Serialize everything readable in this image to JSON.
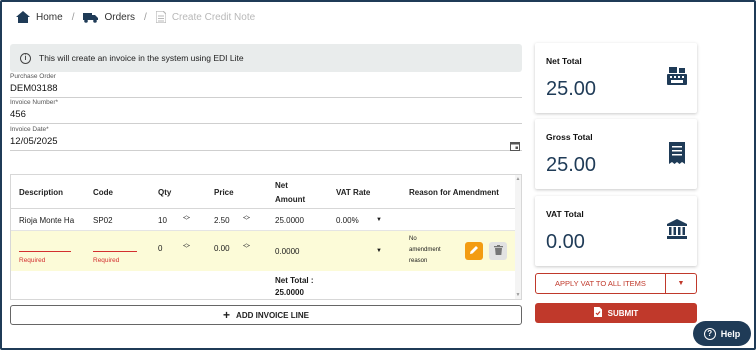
{
  "breadcrumb": {
    "home": "Home",
    "orders": "Orders",
    "current": "Create Credit Note"
  },
  "info": {
    "message": "This will create an invoice in the system using EDI Lite"
  },
  "form": {
    "purchase_order": {
      "label": "Purchase Order",
      "value": "DEM03188"
    },
    "invoice_number": {
      "label": "Invoice Number*",
      "value": "456"
    },
    "invoice_date": {
      "label": "Invoice Date*",
      "value": "12/05/2025"
    }
  },
  "table": {
    "headers": {
      "description": "Description",
      "code": "Code",
      "qty": "Qty",
      "price": "Price",
      "net_amount_1": "Net",
      "net_amount_2": "Amount",
      "vat_rate": "VAT Rate",
      "reason": "Reason for Amendment"
    },
    "row1": {
      "description": "Rioja Monte Ha",
      "code": "SP02",
      "qty": "10",
      "price": "2.50",
      "net_amount": "25.0000",
      "vat_rate": "0.00%"
    },
    "row2": {
      "description_error": "Required",
      "code_error": "Required",
      "qty": "0",
      "price": "0.00",
      "net_amount": "0.0000",
      "reason_1": "No",
      "reason_2": "amendment",
      "reason_3": "reason"
    },
    "footer": {
      "label": "Net Total :",
      "value": "25.0000"
    }
  },
  "add_line": {
    "label": "ADD INVOICE LINE"
  },
  "cards": {
    "net_total": {
      "title": "Net Total",
      "value": "25.00"
    },
    "gross_total": {
      "title": "Gross Total",
      "value": "25.00"
    },
    "vat_total": {
      "title": "VAT Total",
      "value": "0.00"
    }
  },
  "actions": {
    "apply_vat": "APPLY VAT TO ALL ITEMS",
    "submit": "SUBMIT",
    "help": "Help"
  },
  "colors": {
    "navy": "#1f3b57",
    "accent_red": "#c0392b",
    "edit_orange": "#f39c12",
    "highlight_row": "#fcfbd8"
  }
}
